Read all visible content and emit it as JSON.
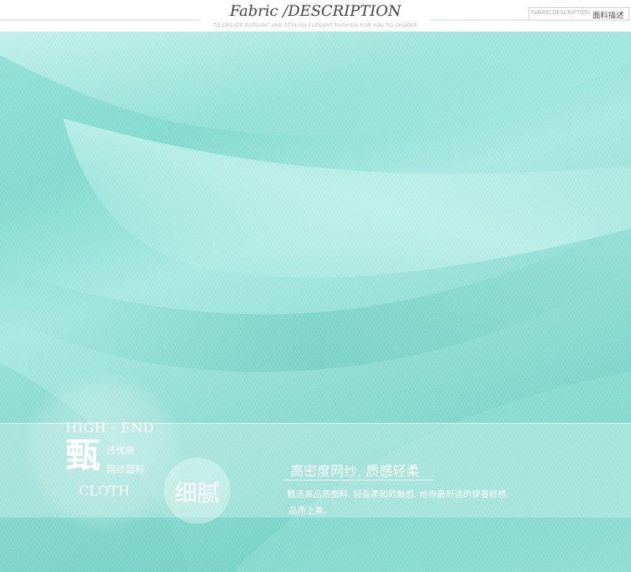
{
  "header": {
    "title": "Fabric /DESCRIPTION",
    "subtitle": "TO CREATE ELEGANT AND STYLISH ELEGANT FASHION FOR YOU TO CHOOSE",
    "tag_en": "FABRIC DESCRIPTION",
    "tag_cn": "面料描述"
  },
  "feature": {
    "high_end": "HIGH - END",
    "big_char": "甄",
    "sub_line1": "选优质",
    "sub_line2": "网纱面料",
    "cloth": "CLOTH",
    "circle_label": "细腻"
  },
  "description": {
    "headline": "高密度网纱, 质感轻柔",
    "line1": "甄选高品质面料, 轻盈柔和的触感, 给你最舒适的穿着舒感,",
    "line2": "品质上乘。"
  },
  "colors": {
    "fabric": "#86dacf",
    "text_light": "#ffffff",
    "header_text": "#444444"
  }
}
